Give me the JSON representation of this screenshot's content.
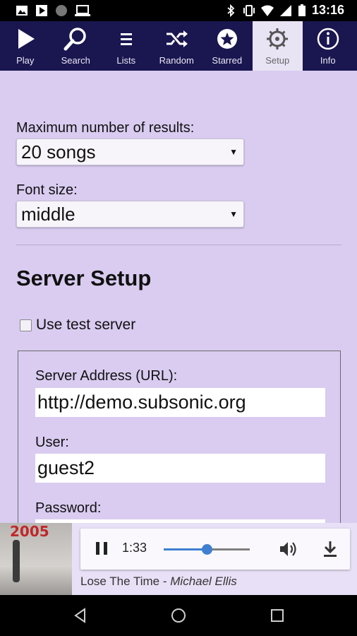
{
  "status_bar": {
    "time": "13:16",
    "left_icons": [
      "gallery-icon",
      "play-store-icon",
      "dot-icon",
      "laptop-icon"
    ],
    "right_icons": [
      "bluetooth-icon",
      "vibrate-icon",
      "wifi-icon",
      "signal-icon",
      "battery-icon"
    ]
  },
  "nav": {
    "items": [
      {
        "label": "Play",
        "icon": "play-icon",
        "active": false
      },
      {
        "label": "Search",
        "icon": "search-icon",
        "active": false
      },
      {
        "label": "Lists",
        "icon": "lists-icon",
        "active": false
      },
      {
        "label": "Random",
        "icon": "shuffle-icon",
        "active": false
      },
      {
        "label": "Starred",
        "icon": "star-icon",
        "active": false
      },
      {
        "label": "Setup",
        "icon": "gear-icon",
        "active": true
      },
      {
        "label": "Info",
        "icon": "info-icon",
        "active": false
      }
    ]
  },
  "settings": {
    "max_results_label": "Maximum number of results:",
    "max_results_value": "20 songs",
    "font_size_label": "Font size:",
    "font_size_value": "middle"
  },
  "server": {
    "heading": "Server Setup",
    "test_server_label": "Use test server",
    "address_label": "Server Address (URL):",
    "address_value": "http://demo.subsonic.org",
    "user_label": "User:",
    "user_value": "guest2",
    "password_label": "Password:"
  },
  "player": {
    "album_year": "2005",
    "elapsed": "1:33",
    "progress": 0.5,
    "track_title": "Lose The Time",
    "separator": " - ",
    "artist": "Michael Ellis"
  },
  "colors": {
    "nav_bg": "#1a1650",
    "page_bg": "#d9ccf0",
    "accent": "#3f7fd0"
  }
}
